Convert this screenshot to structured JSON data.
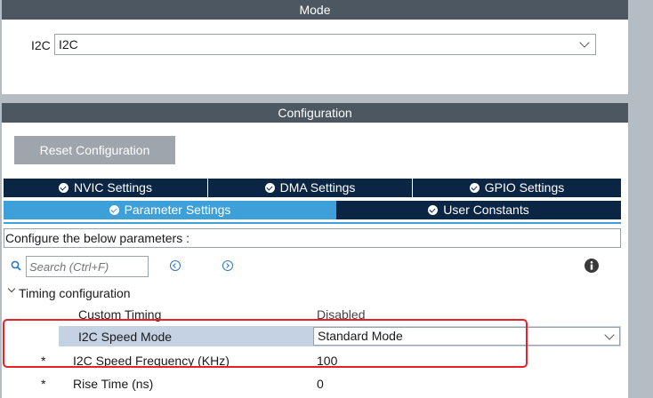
{
  "mode": {
    "header": "Mode",
    "i2c_label": "I2C",
    "i2c_value": "I2C"
  },
  "configuration": {
    "header": "Configuration",
    "reset_button": "Reset Configuration",
    "tabs_row1": [
      "NVIC Settings",
      "DMA Settings",
      "GPIO Settings"
    ],
    "tabs_row2": [
      "Parameter Settings",
      "User Constants"
    ],
    "active_tab": "Parameter Settings",
    "configure_text": "Configure the below parameters :",
    "search_placeholder": "Search (Ctrl+F)"
  },
  "tree": {
    "group_label": "Timing configuration",
    "params": [
      {
        "marker": "",
        "name": "Custom Timing",
        "value": "Disabled"
      },
      {
        "marker": "",
        "name": "I2C Speed Mode",
        "value": "Standard Mode"
      },
      {
        "marker": "*",
        "name": "I2C Speed Frequency (KHz)",
        "value": "100"
      },
      {
        "marker": "*",
        "name": "Rise Time (ns)",
        "value": "0"
      }
    ]
  },
  "colors": {
    "header_bg": "#4d5761",
    "tab_dark": "#0b2544",
    "tab_active": "#3ea0d8",
    "highlight": "#c5d2e4",
    "annotation": "#e8202b"
  }
}
